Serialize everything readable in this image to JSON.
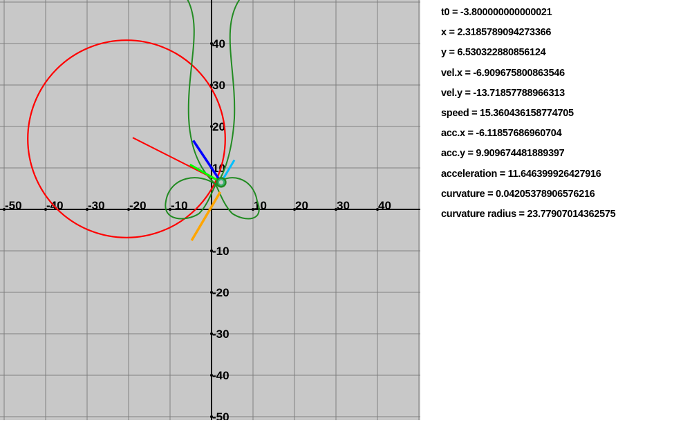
{
  "plot": {
    "background": "#c8c8c8",
    "grid_color": "#7f7f7f",
    "axis_color": "#000000",
    "x_range": [
      -50,
      50
    ],
    "y_range": [
      -50,
      50
    ],
    "tick_step": 10,
    "x_tick_labels": [
      "-50",
      "-40",
      "-30",
      "-20",
      "-10",
      "10",
      "20",
      "30",
      "40"
    ],
    "x_tick_values": [
      -50,
      -40,
      -30,
      -20,
      -10,
      10,
      20,
      30,
      40
    ],
    "y_tick_labels": [
      "40",
      "30",
      "20",
      "10",
      "-10",
      "-20",
      "-30",
      "-40",
      "-50"
    ],
    "y_tick_values": [
      40,
      30,
      20,
      10,
      -10,
      -20,
      -30,
      -40,
      -50
    ],
    "curve": {
      "color": "#228b22",
      "a": 2,
      "b": 1,
      "c": 0.15,
      "d": 0.5,
      "t_start": -8,
      "t_end": 1.6
    },
    "point": {
      "x": 2.3185789094273366,
      "y": 6.530322880856124,
      "fill": "#3cb371",
      "stroke": "#228b22"
    },
    "osculating_circle": {
      "color": "#ff0000",
      "center": [
        -20.5,
        17.0
      ],
      "radius": 23.8
    },
    "vectors": {
      "normal_line": {
        "color": "#ff0000",
        "to": [
          -19.0,
          17.3
        ]
      },
      "velocity": {
        "color": "#0000ff",
        "to": [
          -4.4,
          16.6
        ]
      },
      "velocity_tip": {
        "color": "#00bfff",
        "to": [
          5.5,
          11.9
        ]
      },
      "acceleration": {
        "color": "#00ff00",
        "to": [
          -5.2,
          10.8
        ]
      },
      "acc_tangent": {
        "color": "#ffa500",
        "from": [
          2.1,
          4.2
        ],
        "to": [
          -4.8,
          -7.5
        ]
      }
    }
  },
  "readout": [
    "t0 = -3.800000000000021",
    "x = 2.3185789094273366",
    "y = 6.530322880856124",
    "vel.x = -6.909675800863546",
    "vel.y = -13.71857788966313",
    "speed = 15.360436158774705",
    "acc.x = -6.11857686960704",
    "acc.y = 9.909674481889397",
    "acceleration = 11.646399926427916",
    "curvature = 0.04205378906576216",
    "curvature radius = 23.77907014362575"
  ]
}
